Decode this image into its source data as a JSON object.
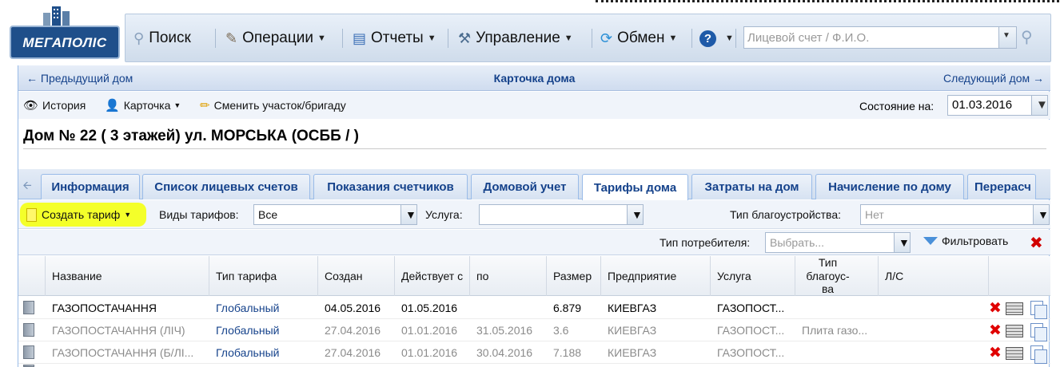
{
  "app": {
    "logo_text": "МЕГАПОЛІС"
  },
  "menu": {
    "search": "Поиск",
    "operations": "Операции",
    "reports": "Отчеты",
    "management": "Управление",
    "exchange": "Обмен",
    "help_icon": "?",
    "account_search_placeholder": "Лицевой счет / Ф.И.О."
  },
  "nav": {
    "prev": "← Предыдущий дом",
    "title": "Карточка дома",
    "next": "Следующий дом →"
  },
  "toolbar": {
    "history": "История",
    "card": "Карточка",
    "change_area": "Сменить участок/бригаду",
    "state_label": "Состояние на:",
    "state_date": "01.03.2016"
  },
  "house": {
    "title": "Дом № 22 ( 3 этажей) ул. МОРСЬКА (ОСББ / )"
  },
  "tabs": [
    {
      "label": "Информация",
      "active": false
    },
    {
      "label": "Список лицевых счетов",
      "active": false
    },
    {
      "label": "Показания счетчиков",
      "active": false
    },
    {
      "label": "Домовой учет",
      "active": false
    },
    {
      "label": "Тарифы дома",
      "active": true
    },
    {
      "label": "Затраты на дом",
      "active": false
    },
    {
      "label": "Начисление по дому",
      "active": false
    },
    {
      "label": "Перерасч",
      "active": false
    }
  ],
  "filters": {
    "create_tariff": "Создать тариф",
    "tariff_types_label": "Виды тарифов:",
    "tariff_types_value": "Все",
    "service_label": "Услуга:",
    "service_value": "",
    "improvement_label": "Тип благоустройства:",
    "improvement_placeholder": "Нет",
    "consumer_label": "Тип потребителя:",
    "consumer_placeholder": "Выбрать...",
    "filter_button": "Фильтровать"
  },
  "columns": [
    "Название",
    "Тип тарифа",
    "Создан",
    "Действует с",
    "по",
    "Размер",
    "Предприятие",
    "Услуга",
    "Тип благоус-ва",
    "Л/С"
  ],
  "rows": [
    {
      "name": "ГАЗОПОСТАЧАННЯ",
      "type": "Глобальный",
      "created": "04.05.2016",
      "from": "01.05.2016",
      "to": "",
      "size": "6.879",
      "company": "КИЕВГАЗ",
      "service": "ГАЗОПОСТ...",
      "improvement": "",
      "ls": "",
      "active": true
    },
    {
      "name": "ГАЗОПОСТАЧАННЯ (ЛІЧ)",
      "type": "Глобальный",
      "created": "27.04.2016",
      "from": "01.01.2016",
      "to": "31.05.2016",
      "size": "3.6",
      "company": "КИЕВГАЗ",
      "service": "ГАЗОПОСТ...",
      "improvement": "Плита газо...",
      "ls": "",
      "active": false
    },
    {
      "name": "ГАЗОПОСТАЧАННЯ (Б/ЛІ...",
      "type": "Глобальный",
      "created": "27.04.2016",
      "from": "01.01.2016",
      "to": "30.04.2016",
      "size": "7.188",
      "company": "КИЕВГАЗ",
      "service": "ГАЗОПОСТ...",
      "improvement": "",
      "ls": "",
      "active": false
    }
  ]
}
